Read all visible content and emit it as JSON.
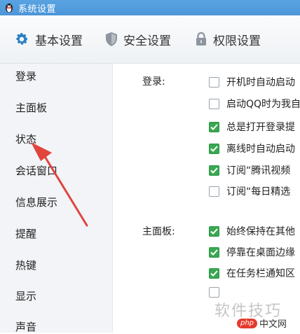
{
  "window": {
    "title": "系统设置"
  },
  "tabs": [
    {
      "label": "基本设置",
      "icon": "gear-icon",
      "active": true
    },
    {
      "label": "安全设置",
      "icon": "shield-icon",
      "active": false
    },
    {
      "label": "权限设置",
      "icon": "lock-icon",
      "active": false
    }
  ],
  "sidebar": {
    "items": [
      {
        "label": "登录"
      },
      {
        "label": "主面板"
      },
      {
        "label": "状态"
      },
      {
        "label": "会话窗口"
      },
      {
        "label": "信息展示"
      },
      {
        "label": "提醒"
      },
      {
        "label": "热键"
      },
      {
        "label": "显示"
      },
      {
        "label": "声音"
      }
    ]
  },
  "sections": {
    "login": {
      "label": "登录:",
      "options": [
        {
          "text": "开机时自动启动",
          "checked": false
        },
        {
          "text": "启动QQ时为我自",
          "checked": false
        },
        {
          "text": "总是打开登录提",
          "checked": true
        },
        {
          "text": "离线时自动启动",
          "checked": true
        },
        {
          "text": "订阅“腾讯视频",
          "checked": true
        },
        {
          "text": "订阅“每日精选",
          "checked": false
        }
      ]
    },
    "mainpanel": {
      "label": "主面板:",
      "options": [
        {
          "text": "始终保持在其他",
          "checked": true
        },
        {
          "text": "停靠在桌面边缘",
          "checked": true
        },
        {
          "text": "在任务栏通知区",
          "checked": true
        },
        {
          "text": "",
          "checked": false
        }
      ]
    }
  },
  "watermark": {
    "text": "软件技巧",
    "badge": "php",
    "site": "中文网"
  },
  "colors": {
    "titlebar": "#4c95d8",
    "checkbox_checked": "#38a851",
    "arrow": "#e0453d"
  }
}
